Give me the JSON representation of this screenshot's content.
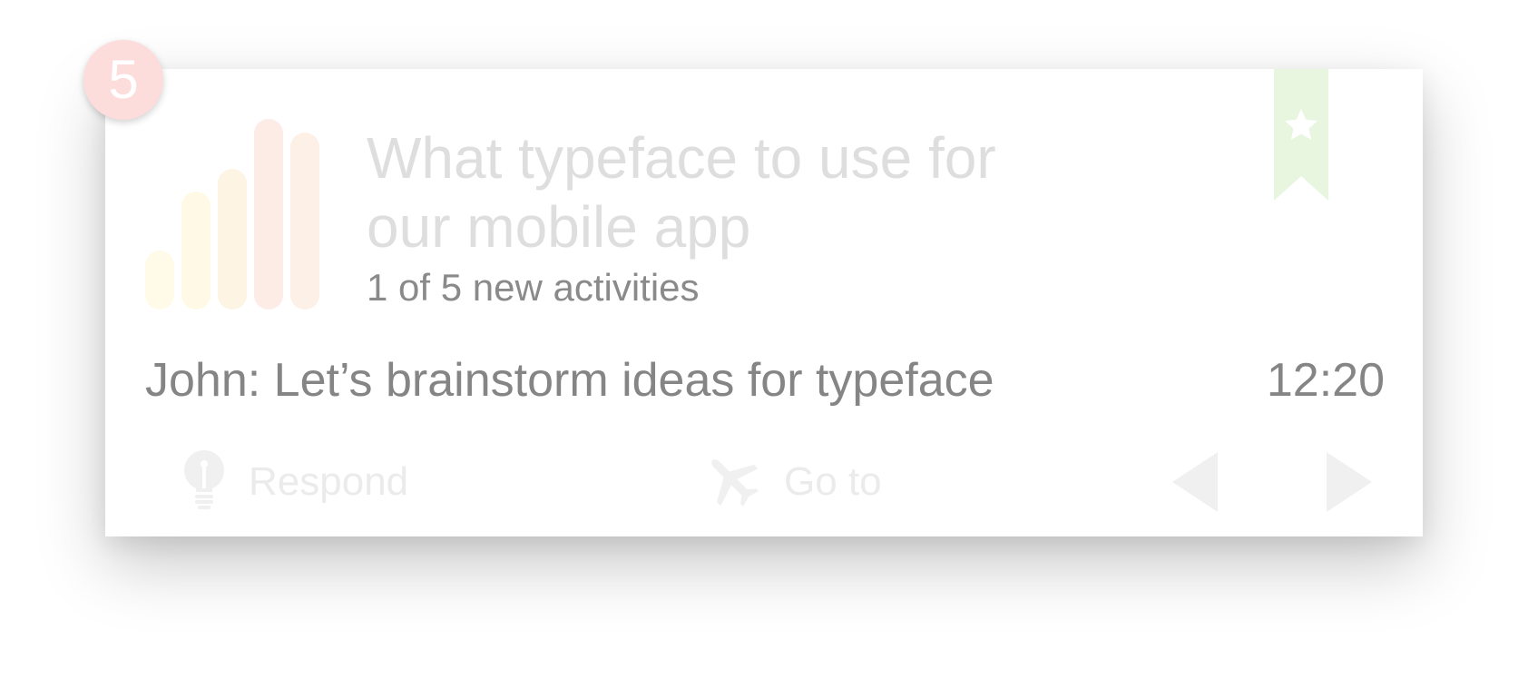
{
  "notification": {
    "badge_count": "5",
    "title": "What typeface to use for our mobile app",
    "subtitle": "1 of 5 new activities",
    "message": "John: Let’s brainstorm ideas for typeface",
    "time": "12:20",
    "bookmarked": true
  },
  "activity_bars": {
    "levels": [
      0.31,
      0.62,
      0.74,
      1.0,
      0.93
    ],
    "colors": [
      "#fffbe8",
      "#fff9e6",
      "#fdf4e4",
      "#fdece6",
      "#fdf0e6"
    ]
  },
  "actions": {
    "respond_label": "Respond",
    "goto_label": "Go to"
  },
  "icons": {
    "respond": "lightbulb-icon",
    "goto": "airplane-icon",
    "prev": "triangle-left-icon",
    "next": "triangle-right-icon",
    "bookmark": "star-bookmark-icon"
  },
  "colors": {
    "badge": "#fddcdc",
    "bookmark": "#e8f6e0",
    "icon_muted": "#f0f0f0",
    "title_text": "#dedede",
    "body_text": "#858585"
  }
}
